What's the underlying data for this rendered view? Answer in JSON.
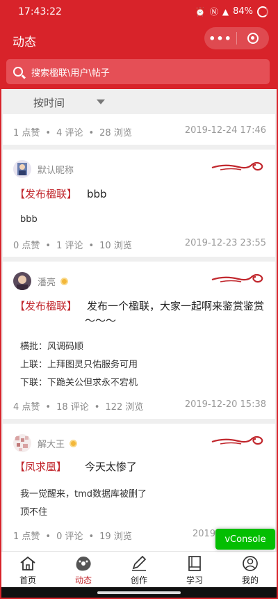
{
  "status_bar": {
    "time": "17:43:22",
    "battery": "84%"
  },
  "nav": {
    "title": "动态",
    "more": "•••"
  },
  "search": {
    "placeholder": "搜索楹联\\用户\\帖子"
  },
  "sort": {
    "label": "按时间"
  },
  "posts": [
    {
      "likes": "1 点赞",
      "comments": "4 评论",
      "views": "28 浏览",
      "date": "2019-12-24 17:46"
    },
    {
      "user": "默认昵称",
      "tag": "【发布楹联】",
      "title": "bbb",
      "lines": [
        "bbb"
      ],
      "likes": "0 点赞",
      "comments": "1 评论",
      "views": "10 浏览",
      "date": "2019-12-23 23:55"
    },
    {
      "user": "潘亮",
      "tag": "【发布楹联】",
      "title": "发布一个楹联，大家一起啊来鉴赏鉴赏",
      "title2": "～～～",
      "lines": [
        "横批：风调码顺",
        "上联：上拜图灵只佑服务可用",
        "下联：下跪关公但求永不宕机"
      ],
      "likes": "4 点赞",
      "comments": "18 评论",
      "views": "122 浏览",
      "date": "2019-12-20 15:38"
    },
    {
      "user": "解大王",
      "tag": "【凤求凰】",
      "title": "今天太惨了",
      "lines": [
        "我一觉醒来，tmd数据库被删了",
        "顶不住"
      ],
      "likes": "1 点赞",
      "comments": "0 评论",
      "views": "19 浏览",
      "date": "2019-"
    }
  ],
  "vconsole": "vConsole",
  "tabs": [
    {
      "label": "首页",
      "icon": "home-icon"
    },
    {
      "label": "动态",
      "icon": "trends-icon",
      "active": true
    },
    {
      "label": "创作",
      "icon": "pen-icon"
    },
    {
      "label": "学习",
      "icon": "book-icon"
    },
    {
      "label": "我的",
      "icon": "user-icon"
    }
  ],
  "colors": {
    "primary": "#d8232a",
    "tag": "#c1272d",
    "vconsole": "#04be02"
  }
}
